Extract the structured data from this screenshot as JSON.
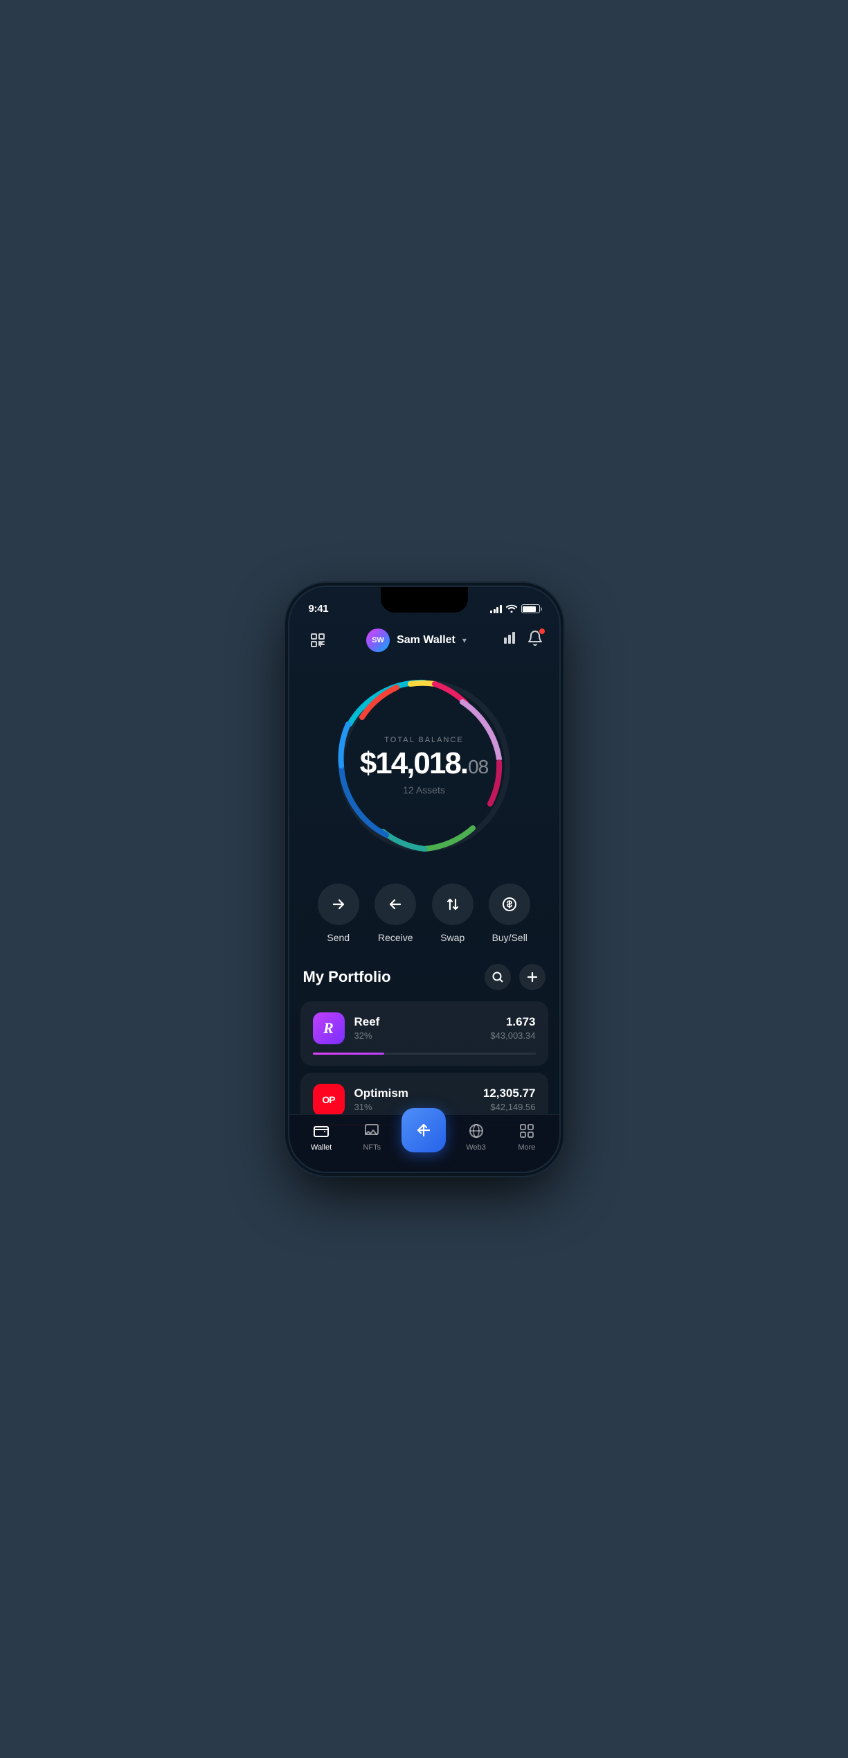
{
  "statusBar": {
    "time": "9:41"
  },
  "header": {
    "scanLabel": "scan",
    "walletName": "Sam Wallet",
    "avatarInitials": "SW",
    "chartLabel": "chart",
    "bellLabel": "notifications"
  },
  "balance": {
    "label": "TOTAL BALANCE",
    "mainAmount": "$14,018.",
    "cents": "08",
    "assets": "12 Assets"
  },
  "actions": [
    {
      "id": "send",
      "label": "Send",
      "icon": "→"
    },
    {
      "id": "receive",
      "label": "Receive",
      "icon": "←"
    },
    {
      "id": "swap",
      "label": "Swap",
      "icon": "⇅"
    },
    {
      "id": "buysell",
      "label": "Buy/Sell",
      "icon": "$"
    }
  ],
  "portfolio": {
    "title": "My Portfolio",
    "searchLabel": "search",
    "addLabel": "add"
  },
  "assets": [
    {
      "id": "reef",
      "name": "Reef",
      "percent": "32%",
      "amount": "1.673",
      "usd": "$43,003.34",
      "barClass": "reef-bar",
      "iconClass": "reef-icon",
      "iconText": "R"
    },
    {
      "id": "optimism",
      "name": "Optimism",
      "percent": "31%",
      "amount": "12,305.77",
      "usd": "$42,149.56",
      "barClass": "op-bar",
      "iconClass": "op-icon",
      "iconText": "OP"
    }
  ],
  "bottomNav": [
    {
      "id": "wallet",
      "label": "Wallet",
      "active": true
    },
    {
      "id": "nfts",
      "label": "NFTs",
      "active": false
    },
    {
      "id": "center",
      "label": "",
      "active": false
    },
    {
      "id": "web3",
      "label": "Web3",
      "active": false
    },
    {
      "id": "more",
      "label": "More",
      "active": false
    }
  ]
}
